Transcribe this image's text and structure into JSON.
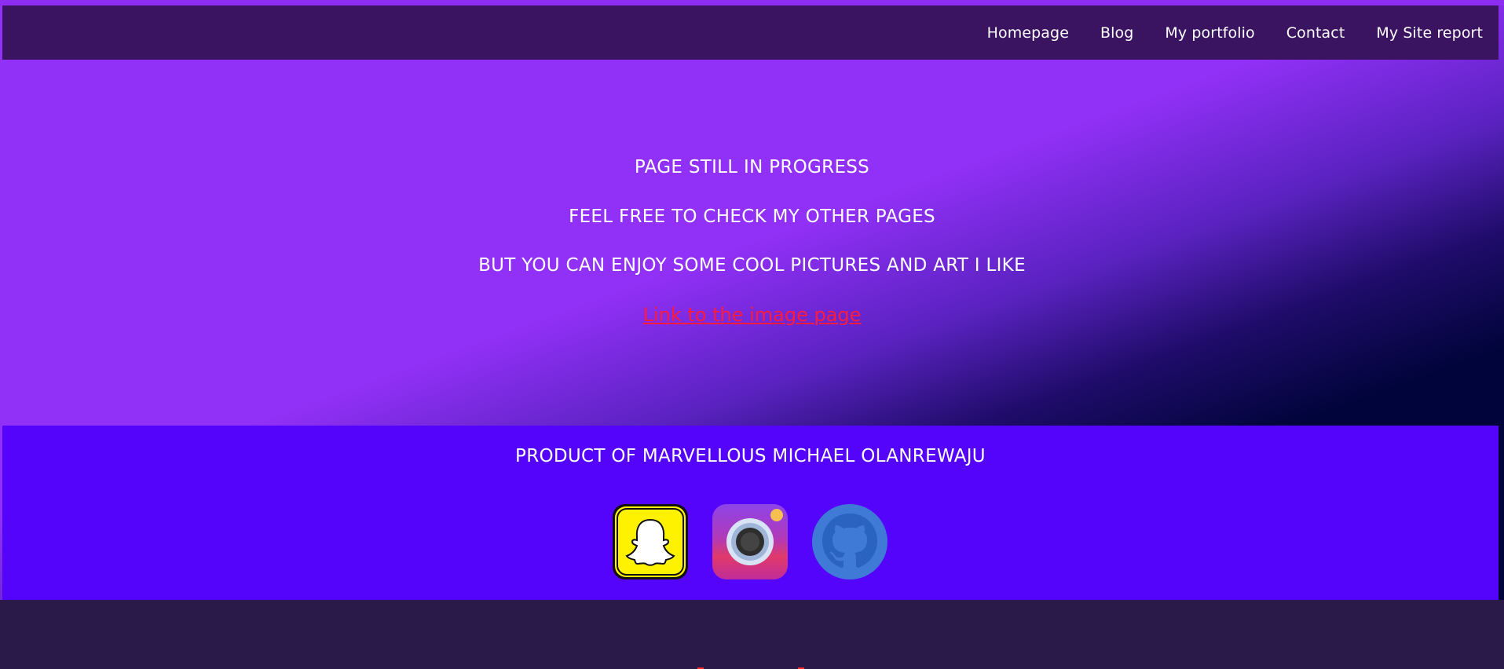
{
  "nav": {
    "links": [
      "Homepage",
      "Blog",
      "My portfolio",
      "Contact",
      "My Site report"
    ]
  },
  "hero": {
    "line1": "PAGE STILL IN PROGRESS",
    "line2": "FEEL FREE TO CHECK MY OTHER PAGES",
    "line3": "BUT YOU CAN ENJOY SOME COOL PICTURES AND ART I LIKE",
    "link_text": "Link to the image page"
  },
  "footer": {
    "title": "PRODUCT OF MARVELLOUS MICHAEL OLANREWAJU",
    "icons": [
      "snapchat-icon",
      "camera-icon",
      "github-icon"
    ]
  },
  "colors": {
    "nav_bg": "#3a1461",
    "hero_purple": "#9130f6",
    "hero_dark": "#01043b",
    "footer_bg": "#5504fc",
    "link_red": "#ff1a3c"
  }
}
